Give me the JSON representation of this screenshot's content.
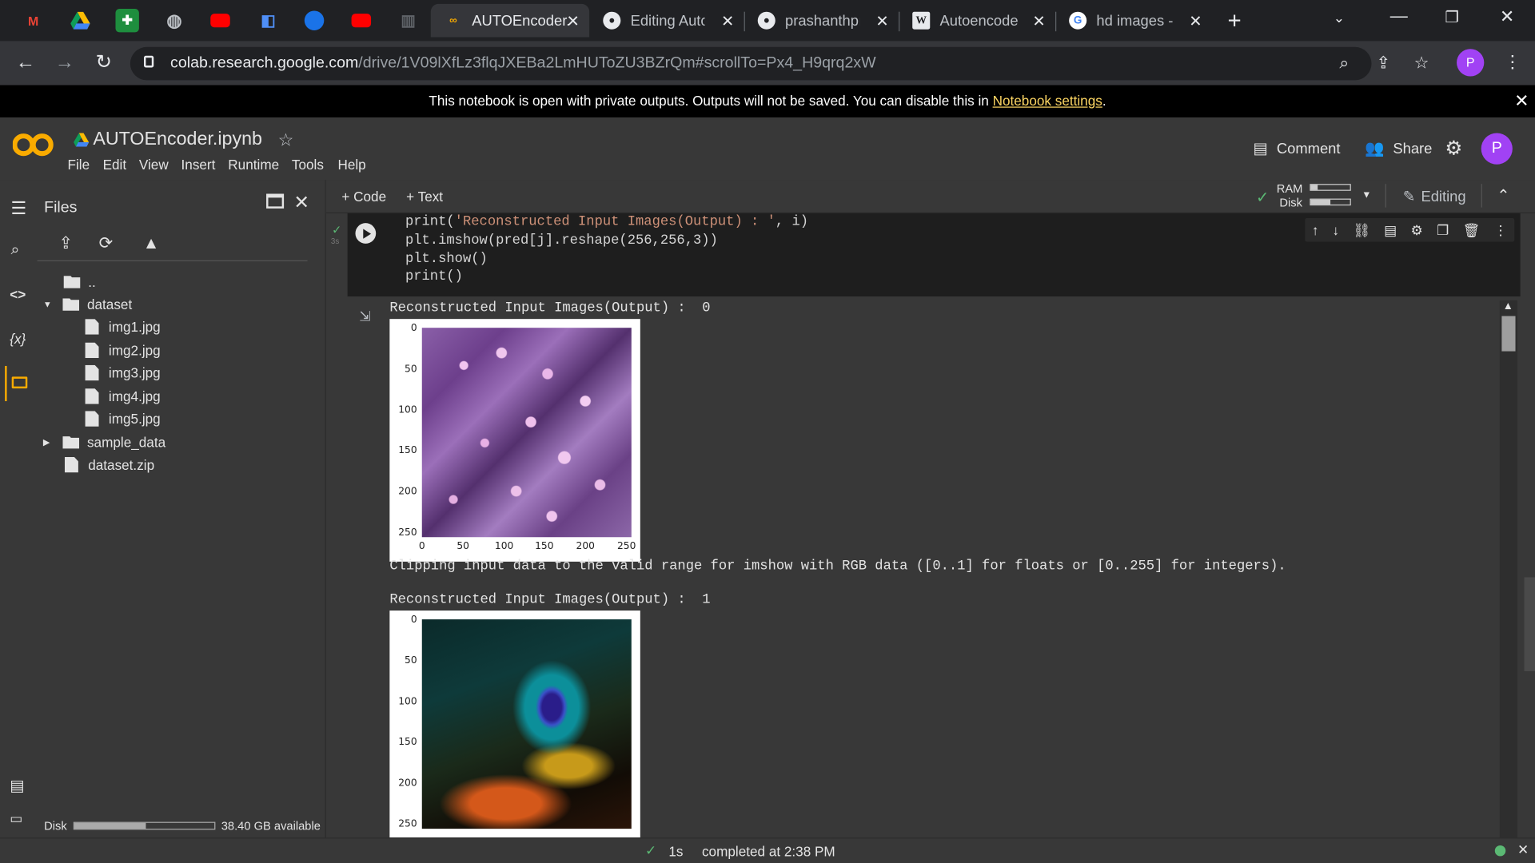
{
  "browser": {
    "tabs": [
      {
        "title": "AUTOEncoder.ipynb",
        "active": true
      },
      {
        "title": "Editing AutoEncoder"
      },
      {
        "title": "prashanthprasad"
      },
      {
        "title": "Autoencoder - Wikipedia"
      },
      {
        "title": "hd images - Google Search"
      }
    ],
    "url_host": "colab.research.google.com",
    "url_path": "/drive/1V09lXfLz3flqJXEBa2LmHUToZU3BZrQm#scrollTo=Px4_H9qrq2xW",
    "profile_initial": "P"
  },
  "banner": {
    "text": "This notebook is open with private outputs. Outputs will not be saved. You can disable this in ",
    "link": "Notebook settings",
    "tail": "."
  },
  "notebook": {
    "logo": "CO",
    "title": "AUTOEncoder.ipynb",
    "menu": [
      "File",
      "Edit",
      "View",
      "Insert",
      "Runtime",
      "Tools",
      "Help"
    ],
    "comment_label": "Comment",
    "share_label": "Share",
    "avatar_initial": "P"
  },
  "toolbar": {
    "code_label": "+ Code",
    "text_label": "+ Text",
    "ram_label": "RAM",
    "disk_label": "Disk",
    "editing_label": "Editing"
  },
  "sidebar": {
    "title": "Files",
    "parent": "..",
    "items": [
      {
        "name": "dataset",
        "type": "folder",
        "expanded": true
      },
      {
        "name": "img1.jpg",
        "type": "file"
      },
      {
        "name": "img2.jpg",
        "type": "file"
      },
      {
        "name": "img3.jpg",
        "type": "file"
      },
      {
        "name": "img4.jpg",
        "type": "file"
      },
      {
        "name": "img5.jpg",
        "type": "file"
      },
      {
        "name": "sample_data",
        "type": "folder",
        "expanded": false
      },
      {
        "name": "dataset.zip",
        "type": "file"
      }
    ],
    "disk_label": "Disk",
    "disk_available": "38.40 GB available"
  },
  "cell": {
    "exec_time": "3s",
    "lines": {
      "l1_a": "print(",
      "l1_str": "'Reconstructed Input Images(Output) : '",
      "l1_b": ", i)",
      "l2": "plt.imshow(pred[j].reshape(256,256,3))",
      "l3": "plt.show()",
      "l4": "print()"
    }
  },
  "output": {
    "label_0": "Reconstructed Input Images(Output) :  0",
    "warning": "Clipping input data to the valid range for imshow with RGB data ([0..1] for floats or [0..255] for integers).",
    "label_1": "Reconstructed Input Images(Output) :  1",
    "yticks": [
      "0",
      "50",
      "100",
      "150",
      "200",
      "250"
    ],
    "xticks": [
      "0",
      "50",
      "100",
      "150",
      "200",
      "250"
    ]
  },
  "status": {
    "duration": "1s",
    "completed": "completed at 2:38 PM"
  }
}
